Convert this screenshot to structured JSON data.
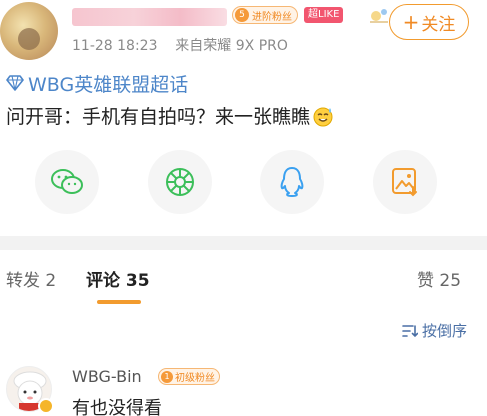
{
  "post": {
    "fan_badge": {
      "level": "5",
      "label": "进阶粉丝"
    },
    "like_badge": "超LIKE",
    "meta": {
      "time": "11-28 18:23",
      "from_prefix": "来自",
      "device": "荣耀 9X PRO"
    },
    "follow_label": "关注",
    "follow_plus": "+",
    "topic": "WBG英雄联盟超话",
    "text": "问开哥：手机有自拍吗？来一张瞧瞧"
  },
  "share_icons": [
    "wechat-icon",
    "moments-icon",
    "qq-icon",
    "save-image-icon"
  ],
  "tabs": {
    "repost": {
      "label": "转发",
      "count": "2"
    },
    "comment": {
      "label": "评论",
      "count": "35"
    },
    "like": {
      "label": "赞",
      "count": "25"
    }
  },
  "sort": {
    "label": "按倒序"
  },
  "comments": [
    {
      "name": "WBG-Bin",
      "badge": {
        "level": "1",
        "label": "初级粉丝"
      },
      "text": "有也没得看"
    }
  ],
  "colors": {
    "accent_orange": "#f29b2e",
    "topic_blue": "#4d86c9",
    "like_badge_red": "#f2566f"
  }
}
